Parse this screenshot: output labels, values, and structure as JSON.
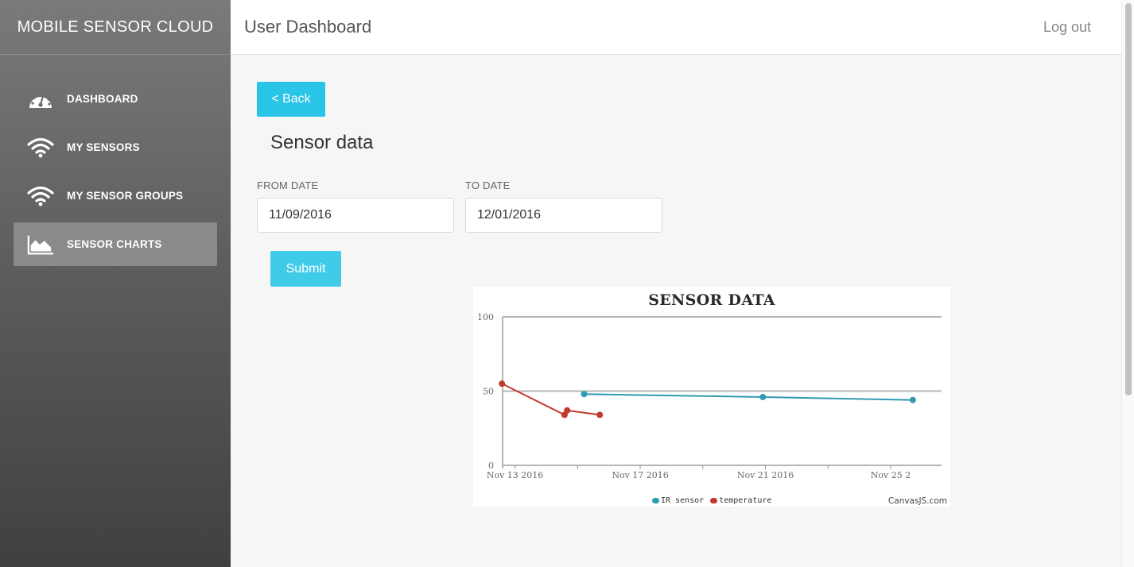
{
  "brand": "MOBILE SENSOR CLOUD",
  "header": {
    "title": "User Dashboard",
    "logout": "Log out"
  },
  "sidebar": {
    "items": [
      {
        "label": "DASHBOARD",
        "icon": "dashboard-gauge-icon"
      },
      {
        "label": "MY SENSORS",
        "icon": "wifi-icon"
      },
      {
        "label": "MY SENSOR GROUPS",
        "icon": "wifi-icon"
      },
      {
        "label": "SENSOR CHARTS",
        "icon": "area-chart-icon",
        "active": true
      }
    ]
  },
  "main": {
    "back_label": "< Back",
    "section_title": "Sensor data",
    "from_label": "FROM DATE",
    "from_value": "11/09/2016",
    "to_label": "TO DATE",
    "to_value": "12/01/2016",
    "submit_label": "Submit"
  },
  "colors": {
    "accent": "#29c4e6",
    "ir_sensor": "#2e9bb0",
    "temperature": "#c0392b"
  },
  "chart_data": {
    "type": "line",
    "title": "SENSOR DATA",
    "ylim": [
      0,
      100
    ],
    "yticks": [
      0,
      50,
      100
    ],
    "xlim": [
      "2016-11-12T14:30",
      "2016-11-26T15:00"
    ],
    "xticks": [
      "Nov 13 2016",
      "Nov 17 2016",
      "Nov 21 2016",
      "Nov 25 2"
    ],
    "grid": true,
    "legend_position": "bottom",
    "credit": "CanvasJS.com",
    "series": [
      {
        "name": "IR sensor",
        "color": "#2e9bb0",
        "points": [
          {
            "x": "2016-11-15T05:00",
            "y": 48
          },
          {
            "x": "2016-11-20T22:00",
            "y": 46
          },
          {
            "x": "2016-11-25T17:00",
            "y": 44
          }
        ]
      },
      {
        "name": "temperature",
        "color": "#c0392b",
        "points": [
          {
            "x": "2016-11-12T14:00",
            "y": 55
          },
          {
            "x": "2016-11-14T14:00",
            "y": 34
          },
          {
            "x": "2016-11-14T16:00",
            "y": 37
          },
          {
            "x": "2016-11-15T17:00",
            "y": 34
          }
        ]
      }
    ]
  }
}
